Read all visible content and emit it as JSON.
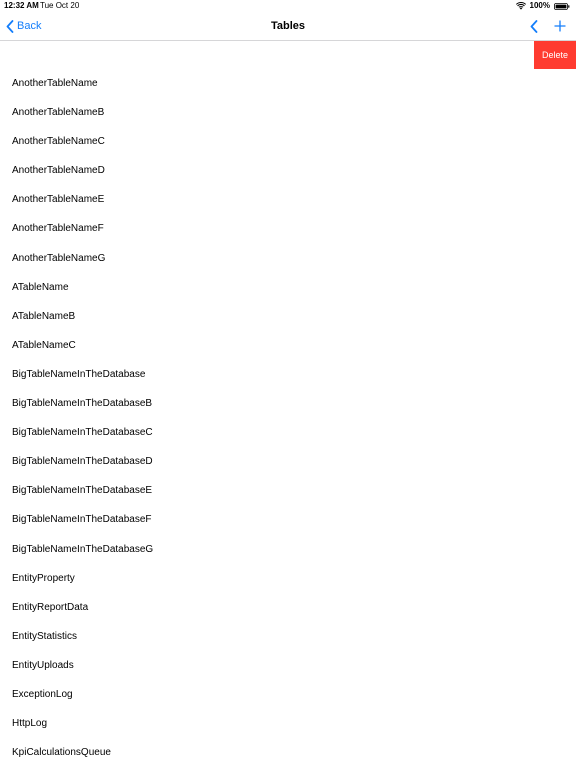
{
  "status_bar": {
    "time": "12:32 AM",
    "date": "Tue Oct 20",
    "battery": "100%",
    "icons": [
      "wifi-icon",
      "battery-icon"
    ]
  },
  "nav": {
    "back_label": "Back",
    "title": "Tables",
    "icons": [
      "chevron-left-icon",
      "plus-icon"
    ],
    "accent_color": "#147efb"
  },
  "swipe_action": {
    "delete_label": "Delete",
    "color": "#ff3b30"
  },
  "tables": [
    "AnotherTableName",
    "AnotherTableNameB",
    "AnotherTableNameC",
    "AnotherTableNameD",
    "AnotherTableNameE",
    "AnotherTableNameF",
    "AnotherTableNameG",
    "ATableName",
    "ATableNameB",
    "ATableNameC",
    "BigTableNameInTheDatabase",
    "BigTableNameInTheDatabaseB",
    "BigTableNameInTheDatabaseC",
    "BigTableNameInTheDatabaseD",
    "BigTableNameInTheDatabaseE",
    "BigTableNameInTheDatabaseF",
    "BigTableNameInTheDatabaseG",
    "EntityProperty",
    "EntityReportData",
    "EntityStatistics",
    "EntityUploads",
    "ExceptionLog",
    "HttpLog",
    "KpiCalculationsQueue"
  ]
}
